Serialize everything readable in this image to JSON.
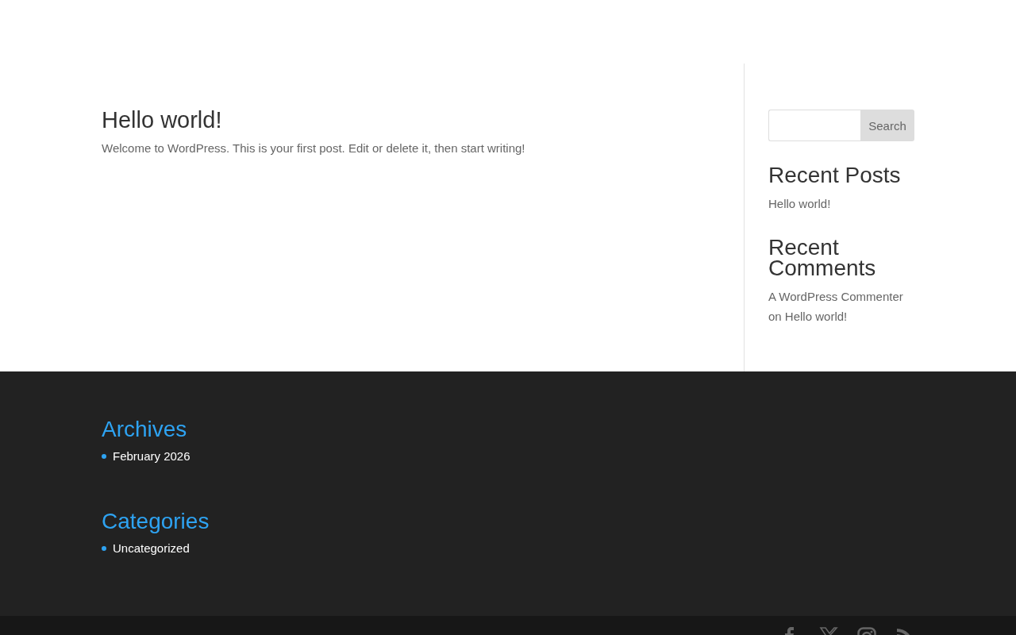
{
  "post": {
    "title": "Hello world!",
    "excerpt": "Welcome to WordPress. This is your first post. Edit or delete it, then start writing!"
  },
  "sidebar": {
    "search": {
      "button": "Search"
    },
    "widgets": [
      {
        "kind": "posts",
        "title": "Recent Posts",
        "items": [
          {
            "post": "Hello world!"
          }
        ]
      },
      {
        "kind": "comments",
        "title": "Recent Comments",
        "items": [
          {
            "author": "A WordPress Commenter",
            "connector": "on",
            "post": "Hello world!"
          }
        ]
      }
    ]
  },
  "footer": {
    "widgets": [
      {
        "title": "Archives",
        "items": [
          "February 2026"
        ]
      },
      {
        "title": "Categories",
        "items": [
          "Uncategorized"
        ]
      }
    ]
  },
  "bottom_bar": {
    "social": [
      {
        "kind": "facebook"
      },
      {
        "kind": "x"
      },
      {
        "kind": "instagram"
      },
      {
        "kind": "rss"
      }
    ]
  }
}
